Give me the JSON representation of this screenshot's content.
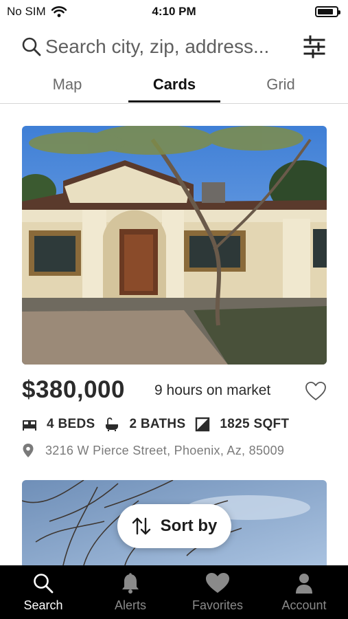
{
  "status_bar": {
    "carrier": "No SIM",
    "time": "4:10 PM",
    "battery_level": 0.85
  },
  "search": {
    "placeholder": "Search city, zip, address..."
  },
  "tabs": [
    {
      "label": "Map",
      "active": false
    },
    {
      "label": "Cards",
      "active": true
    },
    {
      "label": "Grid",
      "active": false
    }
  ],
  "listing": {
    "price": "$380,000",
    "time_on_market": "9 hours on market",
    "beds": "4 BEDS",
    "baths": "2 BATHS",
    "sqft": "1825 SQFT",
    "address": "3216 W Pierce Street, Phoenix, Az, 85009"
  },
  "sort": {
    "label": "Sort by"
  },
  "bottom_nav": [
    {
      "label": "Search",
      "icon": "search-icon",
      "active": true
    },
    {
      "label": "Alerts",
      "icon": "bell-icon",
      "active": false
    },
    {
      "label": "Favorites",
      "icon": "heart-icon",
      "active": false
    },
    {
      "label": "Account",
      "icon": "person-icon",
      "active": false
    }
  ],
  "colors": {
    "nav_background": "#000000",
    "text_primary": "#1f1f1f",
    "text_secondary": "#7a7a7a"
  }
}
